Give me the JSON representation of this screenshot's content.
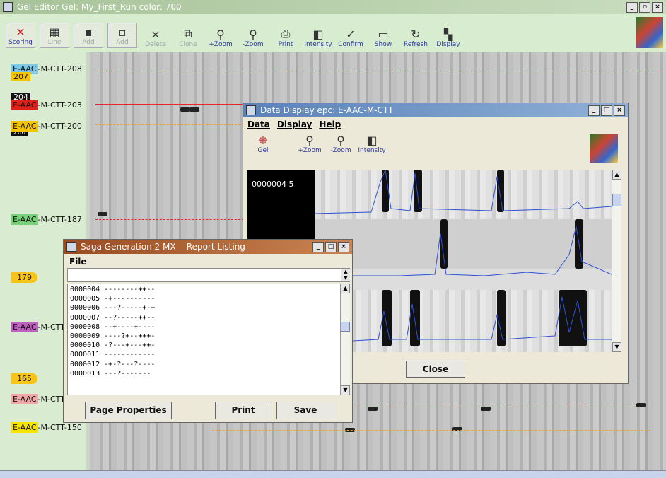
{
  "main": {
    "title": "Gel Editor Gel: My_First_Run color: 700",
    "toolbar": [
      {
        "label": "Scoring",
        "icon": "x-icon"
      },
      {
        "label": "Line",
        "icon": "grid-icon"
      },
      {
        "label": "Add",
        "icon": "add-icon"
      },
      {
        "label": "Add",
        "icon": "add2-icon"
      },
      {
        "label": "Delete",
        "icon": "close-icon"
      },
      {
        "label": "Clone",
        "icon": "clone-icon"
      },
      {
        "label": "+Zoom",
        "icon": "zoom-in-icon"
      },
      {
        "label": "-Zoom",
        "icon": "zoom-out-icon"
      },
      {
        "label": "Print",
        "icon": "print-icon"
      },
      {
        "label": "Intensity",
        "icon": "intensity-icon"
      },
      {
        "label": "Confirm",
        "icon": "confirm-icon"
      },
      {
        "label": "Show",
        "icon": "show-icon"
      },
      {
        "label": "Refresh",
        "icon": "refresh-icon"
      },
      {
        "label": "Display",
        "icon": "display-icon"
      }
    ],
    "markers": [
      {
        "prefix": "E-AAC",
        "suffix": "-M-CTT-208",
        "prefix_color": "#7ec8e8",
        "sub": "207"
      },
      {
        "prefix": "E-AAC",
        "suffix": "-M-CTT-203",
        "prefix_color": "#e0201a",
        "sub": "204"
      },
      {
        "prefix": "E-AAC",
        "suffix": "-M-CTT-200",
        "prefix_color": "#f5c400",
        "sub": "200"
      },
      {
        "prefix": "E-AAC",
        "suffix": "-M-CTT-187",
        "prefix_color": "#7ad07a"
      },
      {
        "prefix": "E-AAC",
        "suffix": "-M-CTT-",
        "prefix_color": "#c060c0"
      },
      {
        "prefix": "E-AAC",
        "suffix": "-M-CTT-",
        "prefix_color": "#f0a8a8"
      },
      {
        "prefix": "E-AAC",
        "suffix": "-M-CTT-150",
        "prefix_color": "#f5e400"
      }
    ],
    "pills": [
      "179",
      "165"
    ]
  },
  "data_display": {
    "title": "Data Display  epc: E-AAC-M-CTT",
    "menu": [
      "Data",
      "Display",
      "Help"
    ],
    "tools": [
      {
        "label": "Gel",
        "icon": "gel-icon"
      },
      {
        "label": "+Zoom",
        "icon": "zoom-in-icon"
      },
      {
        "label": "-Zoom",
        "icon": "zoom-out-icon"
      },
      {
        "label": "Intensity",
        "icon": "intensity-icon"
      }
    ],
    "sample_label": "0000004 5",
    "close_label": "Close"
  },
  "report": {
    "title": "Saga Generation 2 MX    Report Listing",
    "menu": "File",
    "rows": [
      "0000004 --------++--",
      "0000005 -+----------",
      "0000006 ---?-----+-+",
      "0000007 --?-----++--",
      "0000008 --+----+----",
      "0000009 ----?+--+++-",
      "0000010 -?---+---++-",
      "0000011 ------------",
      "0000012 -+-?---?----",
      "0000013 ---?-------"
    ],
    "buttons": {
      "page_properties": "Page Properties",
      "print": "Print",
      "save": "Save"
    }
  }
}
